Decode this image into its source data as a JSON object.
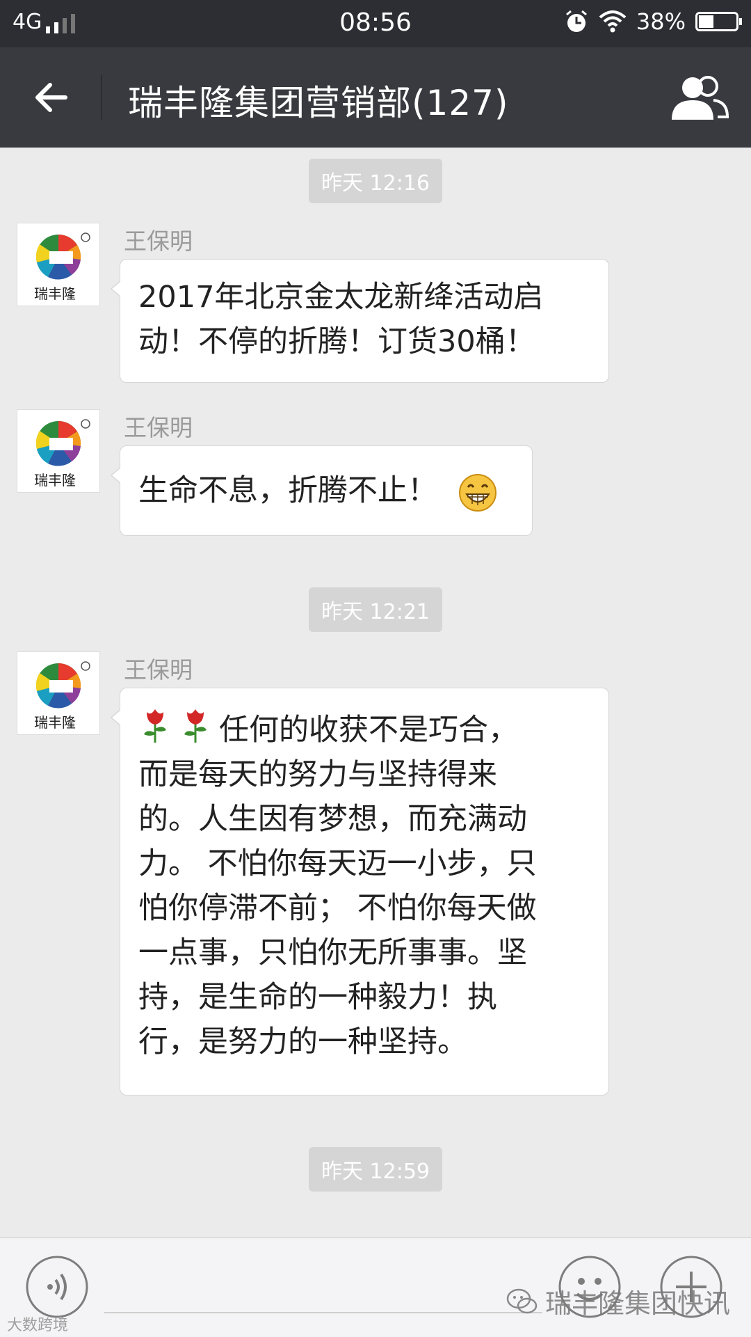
{
  "status_bar": {
    "network": "4G",
    "time": "08:56",
    "battery_percent": "38%",
    "battery_level": 0.38,
    "icons": [
      "signal-icon",
      "alarm-icon",
      "wifi-icon",
      "battery-icon"
    ]
  },
  "header": {
    "title": "瑞丰隆集团营销部(127)",
    "back_icon": "arrow-left-icon",
    "members_icon": "group-members-icon"
  },
  "avatar": {
    "logo_text": "瑞丰隆",
    "registered_mark": "®"
  },
  "timestamps": [
    "昨天 12:16",
    "昨天 12:21",
    "昨天 12:59"
  ],
  "messages": [
    {
      "sender": "王保明",
      "lines": [
        "2017年北京金太龙新绛活动启",
        "动！不停的折腾！订货30桶！"
      ]
    },
    {
      "sender": "王保明",
      "lines": [
        "生命不息，折腾不止！"
      ],
      "emoji": "grinning-face-icon"
    },
    {
      "sender": "王保明",
      "prefix_icons": [
        "rose-icon",
        "rose-icon"
      ],
      "lines": [
        "任何的收获不是巧合，",
        "而是每天的努力与坚持得来",
        "的。人生因有梦想，而充满动",
        "力。 不怕你每天迈一小步，只",
        "怕你停滞不前； 不怕你每天做",
        "一点事，只怕你无所事事。坚",
        "持，是生命的一种毅力！执",
        "行，是努力的一种坚持。"
      ]
    }
  ],
  "input_bar": {
    "voice_icon": "voice-icon",
    "emoji_icon": "emoji-icon",
    "plus_icon": "plus-icon"
  },
  "watermark": {
    "text": "瑞丰隆集团快讯",
    "corner_text": "大数跨境"
  }
}
